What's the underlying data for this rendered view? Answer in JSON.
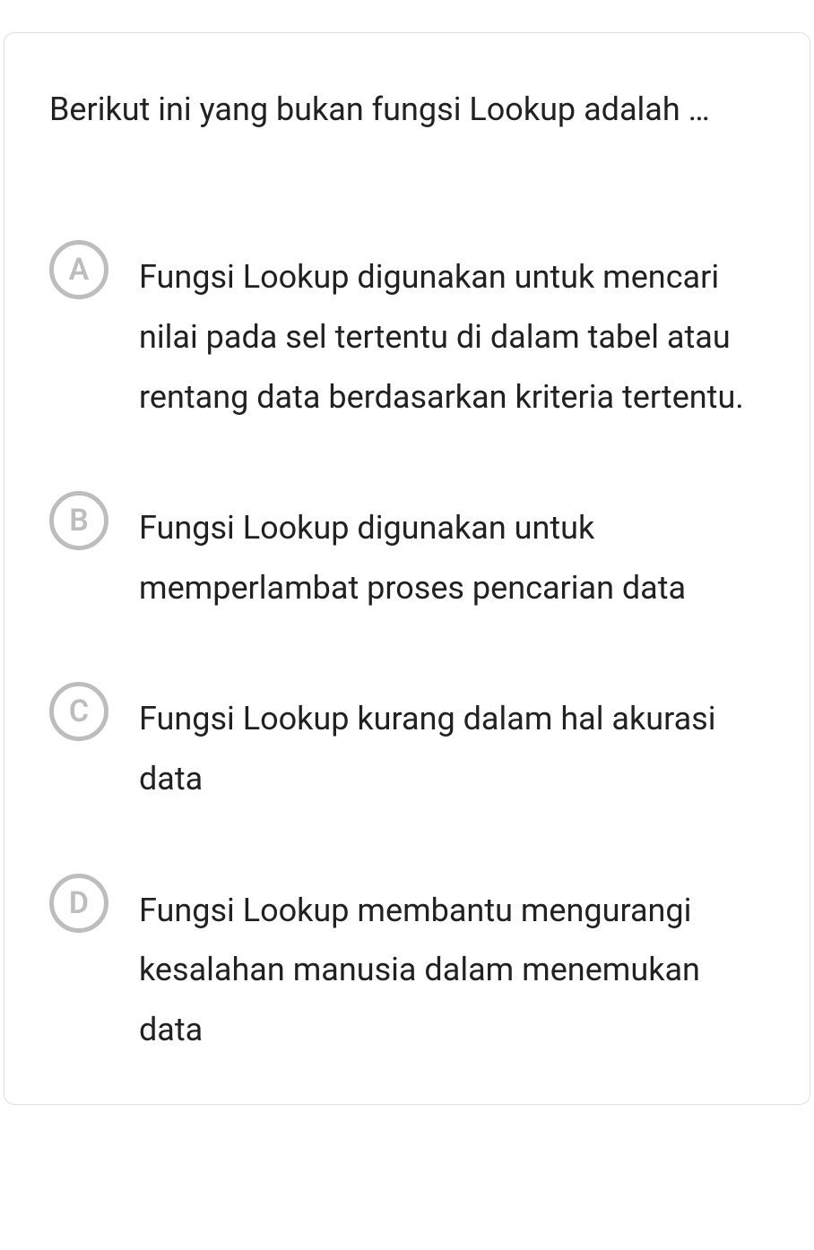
{
  "question": "Berikut ini yang bukan fungsi Lookup adalah …",
  "options": [
    {
      "letter": "A",
      "text": "Fungsi Lookup digunakan untuk mencari nilai pada sel tertentu di dalam tabel atau rentang data berdasarkan kriteria tertentu."
    },
    {
      "letter": "B",
      "text": "Fungsi Lookup digunakan untuk memperlambat proses pencarian data"
    },
    {
      "letter": "C",
      "text": "Fungsi Lookup kurang dalam hal akurasi data"
    },
    {
      "letter": "D",
      "text": "Fungsi Lookup membantu mengurangi kesalahan manusia dalam menemukan data"
    }
  ]
}
